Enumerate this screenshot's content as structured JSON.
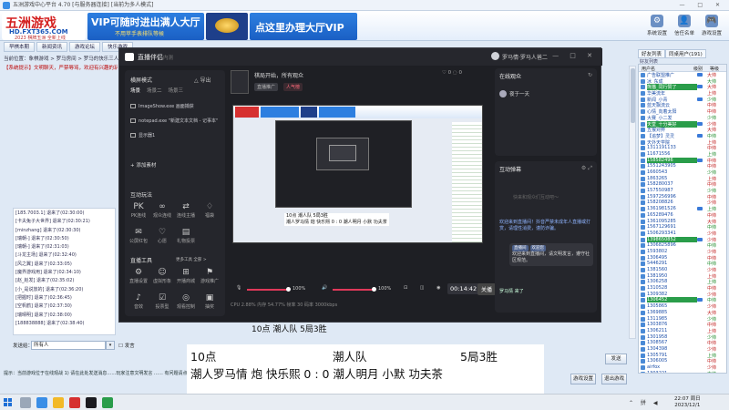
{
  "host": {
    "title": "五洲游戏中心平台 4.70 [与服务器连接] [当前为多人模式]",
    "logo": {
      "line1": "五洲游戏",
      "line2": "HD.FXT365.COM",
      "line3": "2023 棋牌五洲 全新上线"
    },
    "ad_left": {
      "line1": "VIP可随时进出满人大厅",
      "line2": "不用苹手表排队等候"
    },
    "ad_right": "点这里办理大厅VIP",
    "tool_buttons": [
      {
        "label": "系统设置",
        "icon": "⚙"
      },
      {
        "label": "信任名单",
        "icon": "👤"
      },
      {
        "label": "游戏设置",
        "icon": "🎮"
      },
      {
        "label": "退出游戏",
        "icon": "⏏"
      }
    ],
    "tabs": [
      "早棋本期",
      "新闻资讯",
      "游戏论坛",
      "快乐游戏"
    ],
    "breadcrumb": "当前位置：象棋游戏 > 罗马房间 > 罗马的快乐三人间",
    "notice": "【系统提示】文明聊天，严禁辱骂，欢迎有兴趣的玩家…",
    "chat_lines": [
      "[185.7003.1] 退来了(02:30:00)",
      "[卡夫兔子大世界] 退来了(02:30:21)",
      "[minzhang] 退来了(02:30:30)",
      "[瑞朝-] 退来了(02:30:50)",
      "[瑞朝-] 退来了(02:31:03)",
      "[斗龙主场] 退来了(02:32:40)",
      "[风之翼] 退来了(02:33:05)",
      "[魔界游戏用] 退来了(02:34:10)",
      "[赵_赵发] 退来了(02:35:02)",
      "[小_是说放的] 退来了(02:36:20)",
      "[把握时] 退来了(02:36:45)",
      "[空帆鹤] 退来了(02:37:30)",
      "[瑞晴明] 退来了(02:38:00)",
      "[188838888] 退来了(02:38:40)"
    ],
    "send_label": "发送给：",
    "send_to": "所有人",
    "checkbox_label": "发言",
    "tip": "提示：当前游戏位于在线观战 1) 请在此处发送消息……玩家注意文明发言 …… 有问题请点击“帮助”",
    "send_button": "发送",
    "bottom_buttons": [
      "游戏设置",
      "退出游戏"
    ],
    "right_tabs": [
      "好友列表",
      "同桌用户(191)"
    ],
    "right_search": "好友列表",
    "player_header": [
      "用户名",
      "级别",
      "等级"
    ],
    "players": [
      {
        "name": "广告联盟推广",
        "lv": "大帅",
        "hl": false,
        "vip": true
      },
      {
        "name": "冰_东成",
        "lv": "大帅",
        "hl": false,
        "vip": false
      },
      {
        "name": "熊猫_同行赞了",
        "lv": "大帅",
        "hl": true,
        "vip": true
      },
      {
        "name": "华美流年",
        "lv": "上帅",
        "hl": false,
        "vip": false
      },
      {
        "name": "新闻_小青",
        "lv": "少帅",
        "hl": false,
        "vip": true
      },
      {
        "name": "蓝天飘流云",
        "lv": "中帅",
        "hl": false,
        "vip": false
      },
      {
        "name": "心情_向着太阳",
        "lv": "中帅",
        "hl": false,
        "vip": false
      },
      {
        "name": "大赛_小二发",
        "lv": "少帅",
        "hl": false,
        "vip": false
      },
      {
        "name": "天堂_十分美好",
        "lv": "少帅",
        "hl": true,
        "vip": true
      },
      {
        "name": "五猴对弈",
        "lv": "大帅",
        "hl": false,
        "vip": false
      },
      {
        "name": "【追梦】灵灵",
        "lv": "中帅",
        "hl": false,
        "vip": true
      },
      {
        "name": "天外天学院",
        "lv": "上帅",
        "hl": false,
        "vip": false
      },
      {
        "name": "1311191133",
        "lv": "中帅",
        "hl": false,
        "vip": false
      },
      {
        "name": "11671556",
        "lv": "上帅",
        "hl": false,
        "vip": false
      },
      {
        "name": "158582496",
        "lv": "中帅",
        "hl": true,
        "vip": true
      },
      {
        "name": "1551243905",
        "lv": "中帅",
        "hl": false,
        "vip": false
      },
      {
        "name": "1660543",
        "lv": "少帅",
        "hl": false,
        "vip": false
      },
      {
        "name": "1863265",
        "lv": "上帅",
        "hl": false,
        "vip": false
      },
      {
        "name": "158280037",
        "lv": "中帅",
        "hl": false,
        "vip": false
      },
      {
        "name": "157550987",
        "lv": "少帅",
        "hl": false,
        "vip": false
      },
      {
        "name": "1597256996",
        "lv": "中帅",
        "hl": false,
        "vip": false
      },
      {
        "name": "158208826",
        "lv": "少帅",
        "hl": false,
        "vip": false
      },
      {
        "name": "1361981526",
        "lv": "上帅",
        "hl": false,
        "vip": true
      },
      {
        "name": "165289476",
        "lv": "中帅",
        "hl": false,
        "vip": false
      },
      {
        "name": "1361095285",
        "lv": "大帅",
        "hl": false,
        "vip": false
      },
      {
        "name": "1567129691",
        "lv": "中帅",
        "hl": false,
        "vip": false
      },
      {
        "name": "1506293341",
        "lv": "少帅",
        "hl": false,
        "vip": false
      },
      {
        "name": "1398650852",
        "lv": "少帅",
        "hl": true,
        "vip": true
      },
      {
        "name": "1306825896",
        "lv": "中帅",
        "hl": false,
        "vip": false
      },
      {
        "name": "1593802",
        "lv": "少帅",
        "hl": false,
        "vip": false
      },
      {
        "name": "1306495",
        "lv": "中帅",
        "hl": false,
        "vip": false
      },
      {
        "name": "5446291",
        "lv": "中帅",
        "hl": false,
        "vip": false
      },
      {
        "name": "1381560",
        "lv": "少帅",
        "hl": false,
        "vip": false
      },
      {
        "name": "1381950",
        "lv": "上帅",
        "hl": false,
        "vip": false
      },
      {
        "name": "1306258",
        "lv": "上帅",
        "hl": false,
        "vip": false
      },
      {
        "name": "1310528",
        "lv": "中帅",
        "hl": false,
        "vip": false
      },
      {
        "name": "1309382",
        "lv": "少帅",
        "hl": false,
        "vip": false
      },
      {
        "name": "1306452",
        "lv": "中帅",
        "hl": true,
        "vip": true
      },
      {
        "name": "1305865",
        "lv": "少帅",
        "hl": false,
        "vip": false
      },
      {
        "name": "1369885",
        "lv": "大帅",
        "hl": false,
        "vip": false
      },
      {
        "name": "1311985",
        "lv": "少帅",
        "hl": false,
        "vip": false
      },
      {
        "name": "1303876",
        "lv": "中帅",
        "hl": false,
        "vip": false
      },
      {
        "name": "1306211",
        "lv": "上帅",
        "hl": false,
        "vip": false
      },
      {
        "name": "1301958",
        "lv": "少帅",
        "hl": false,
        "vip": false
      },
      {
        "name": "1308567",
        "lv": "中帅",
        "hl": false,
        "vip": false
      },
      {
        "name": "1304398",
        "lv": "少帅",
        "hl": false,
        "vip": false
      },
      {
        "name": "1305791",
        "lv": "上帅",
        "hl": false,
        "vip": false
      },
      {
        "name": "1306005",
        "lv": "中帅",
        "hl": false,
        "vip": false
      },
      {
        "name": "airfox",
        "lv": "少帅",
        "hl": false,
        "vip": false
      },
      {
        "name": "1303221",
        "lv": "中帅",
        "hl": false,
        "vip": false
      }
    ]
  },
  "live": {
    "app_name": "直播伴侣",
    "app_tag": "内测",
    "user": "罗马情·罗马人爸二",
    "window_controls": "— □ ✕",
    "scene_section": "横屏模式",
    "scene_toggle": "△ 导出",
    "scene_tabs": [
      "场景",
      "场景二",
      "场景三"
    ],
    "sources": [
      "ImageShow.exe 画面捕获",
      "notepad.exe \"新建文本文档 - 记事本\"",
      "显示器1"
    ],
    "add_source": "+ 添加素材",
    "interact_section": "互动玩法",
    "interact_tools": [
      {
        "label": "PK连线",
        "glyph": "PK"
      },
      {
        "label": "观众连线",
        "glyph": "∞"
      },
      {
        "label": "连线主播",
        "glyph": "⇄"
      },
      {
        "label": "福袋",
        "glyph": "♢"
      },
      {
        "label": "公屏红包",
        "glyph": "✉"
      },
      {
        "label": "心愿",
        "glyph": "♡"
      },
      {
        "label": "礼物投票",
        "glyph": "▤"
      }
    ],
    "tools_section": "直播工具",
    "tools_links": "更多工具  全部 >",
    "live_tools": [
      {
        "label": "直播设置",
        "glyph": "⚙"
      },
      {
        "label": "虚拟形象",
        "glyph": "☺"
      },
      {
        "label": "开播商城",
        "glyph": "⊞"
      },
      {
        "label": "游戏推广",
        "glyph": "⚑"
      },
      {
        "label": "音效",
        "glyph": "♪"
      },
      {
        "label": "投票型",
        "glyph": "☑"
      },
      {
        "label": "观看控制",
        "glyph": "◎"
      },
      {
        "label": "抽奖",
        "glyph": "▣"
      }
    ],
    "preview_title": "棋局开始，所有观众",
    "chip_gray": "直播推广",
    "chip_red": "人气榜",
    "preview_stats": "♡ 0   ◌ 0",
    "share_label": "分享",
    "canvas_lines": [
      "10点                          潮人队                    5局3胜",
      "潮人罗马情  炮  快乐熙  0 : 0  潮人明月  小默  功夫茶"
    ],
    "volume_mic": "100%",
    "volume_desktop": "100%",
    "timer": "00:14:42",
    "stop_label": "关播",
    "status": "CPU 2.88%   内存 54.77%   帧率 30   码率 3000kbps",
    "online_title": "在线观众",
    "online_icon": "↻",
    "online_user": "夜于一天",
    "danmu_title": "互动弹幕",
    "danmu_icons": "⚙  ⤢",
    "danmu_placeholder": "快来和观众们互动吧～",
    "sys_msg": "欢迎来到直播间！抖音严禁未成年人直播或打赏，请理性消费，谨防诈骗。",
    "bubble_tags": [
      "直播间",
      "欢迎您"
    ],
    "bubble_text": "欢迎来到直播间，请文明发言，遵守社区规范。",
    "last_msg": "罗马情 来了"
  },
  "subtitle": {
    "r1_left": "10点",
    "r1_mid": "潮人队",
    "r1_right": "5局3胜",
    "r2": "潮人罗马情   炮   快乐熙   0  :  0   潮人明月  小默   功夫茶"
  },
  "taskbar": {
    "time": "22:07 周日",
    "date": "2023/12/1",
    "tray": "⌃ 拼 ◀"
  }
}
